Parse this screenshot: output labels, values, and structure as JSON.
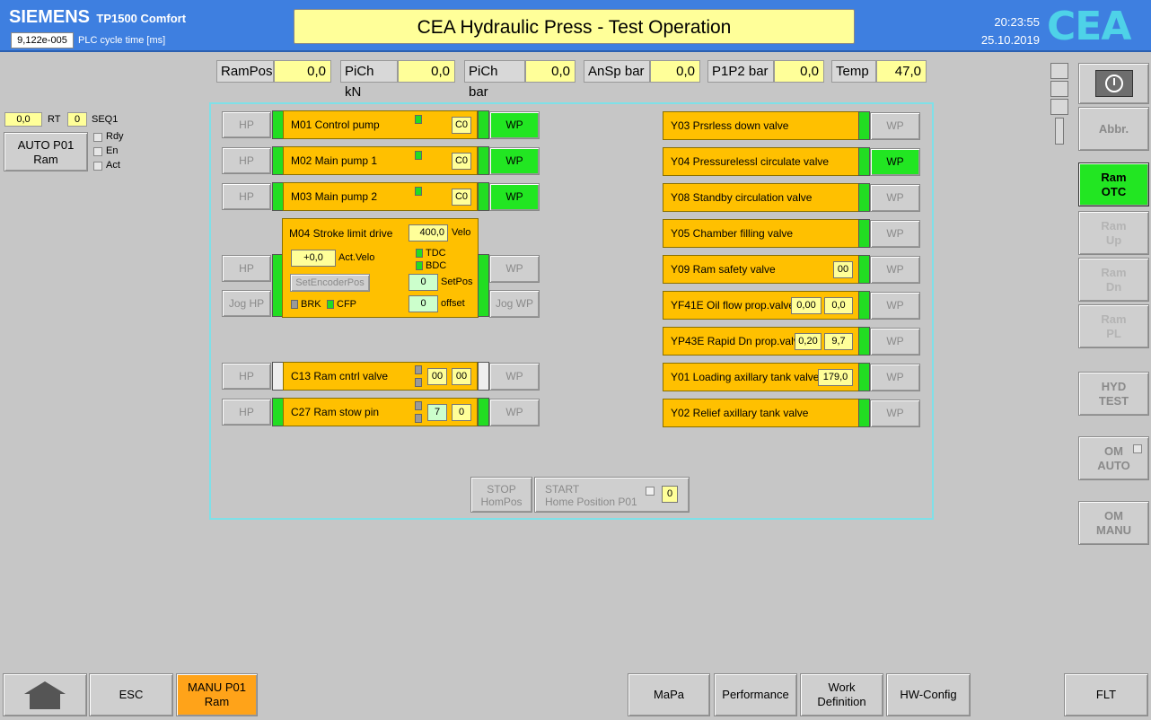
{
  "header": {
    "brand": "SIEMENS",
    "model": "TP1500 Comfort",
    "cycle_value": "9,122e-005",
    "cycle_label": "PLC cycle time [ms]",
    "title": "CEA Hydraulic Press - Test Operation",
    "time": "20:23:55",
    "date": "25.10.2019",
    "logo": "CEA"
  },
  "readouts": [
    {
      "label": "RamPos",
      "value": "0,0"
    },
    {
      "label": "PiCh kN",
      "value": "0,0"
    },
    {
      "label": "PiCh bar",
      "value": "0,0"
    },
    {
      "label": "AnSp bar",
      "value": "0,0"
    },
    {
      "label": "P1P2 bar",
      "value": "0,0"
    },
    {
      "label": "Temp",
      "value": "47,0"
    }
  ],
  "left_panel": {
    "rt_value": "0,0",
    "rt_label": "RT",
    "seq_value": "0",
    "seq_label": "SEQ1",
    "auto_button": "AUTO P01 Ram",
    "status": [
      "Rdy",
      "En",
      "Act"
    ]
  },
  "drives": [
    {
      "name": "M01 Control pump",
      "code": "C0",
      "hp": "HP",
      "wp": "WP"
    },
    {
      "name": "M02 Main pump 1",
      "code": "C0",
      "hp": "HP",
      "wp": "WP"
    },
    {
      "name": "M03 Main pump 2",
      "code": "C0",
      "hp": "HP",
      "wp": "WP"
    }
  ],
  "m04": {
    "name": "M04 Stroke limit drive",
    "velo_value": "400,0",
    "velo_label": "Velo",
    "act_value": "+0,0",
    "act_label": "Act.Velo",
    "tdc": "TDC",
    "bdc": "BDC",
    "set_encoder": "SetEncoderPos",
    "setpos_value": "0",
    "setpos_label": "SetPos",
    "offset_value": "0",
    "offset_label": "offset",
    "brk": "BRK",
    "cfp": "CFP",
    "hp": "HP",
    "jog_hp": "Jog HP",
    "wp": "WP",
    "jog_wp": "Jog WP"
  },
  "c13": {
    "name": "C13 Ram cntrl valve",
    "v1": "00",
    "v2": "00",
    "hp": "HP",
    "wp": "WP"
  },
  "c27": {
    "name": "C27 Ram stow pin",
    "v1": "7",
    "v2": "0",
    "hp": "HP",
    "wp": "WP"
  },
  "valves": [
    {
      "name": "Y03 Prsrless down valve",
      "wp": "WP"
    },
    {
      "name": "Y04 Pressurelessl circulate valve",
      "wp": "WP"
    },
    {
      "name": "Y08 Standby circulation valve",
      "wp": "WP"
    },
    {
      "name": "Y05 Chamber filling valve",
      "wp": "WP"
    },
    {
      "name": "Y09 Ram safety valve",
      "v1": "00",
      "wp": "WP"
    },
    {
      "name": "YF41E Oil flow prop.valve",
      "v1": "0,00",
      "v2": "0,0",
      "wp": "WP"
    },
    {
      "name": "YP43E Rapid Dn prop.valve",
      "v1": "0,20",
      "v2": "9,7",
      "wp": "WP"
    },
    {
      "name": "Y01 Loading axillary tank valve",
      "v1": "179,0",
      "wp": "WP"
    },
    {
      "name": "Y02 Relief axillary tank valve",
      "wp": "WP"
    }
  ],
  "home": {
    "stop_line1": "STOP",
    "stop_line2": "HomPos",
    "start_line1": "START",
    "start_line2": "Home Position P01",
    "start_value": "0"
  },
  "side_buttons": {
    "abbr": "Abbr.",
    "ram_otc_1": "Ram",
    "ram_otc_2": "OTC",
    "ram_up_1": "Ram",
    "ram_up_2": "Up",
    "ram_dn_1": "Ram",
    "ram_dn_2": "Dn",
    "ram_pl_1": "Ram",
    "ram_pl_2": "PL",
    "hyd_1": "HYD",
    "hyd_2": "TEST",
    "om_auto_1": "OM",
    "om_auto_2": "AUTO",
    "om_manu_1": "OM",
    "om_manu_2": "MANU"
  },
  "bottom": {
    "esc": "ESC",
    "manu_1": "MANU P01",
    "manu_2": "Ram",
    "mapa": "MaPa",
    "performance": "Performance",
    "work_1": "Work",
    "work_2": "Definition",
    "hwconfig": "HW-Config",
    "flt": "FLT"
  }
}
